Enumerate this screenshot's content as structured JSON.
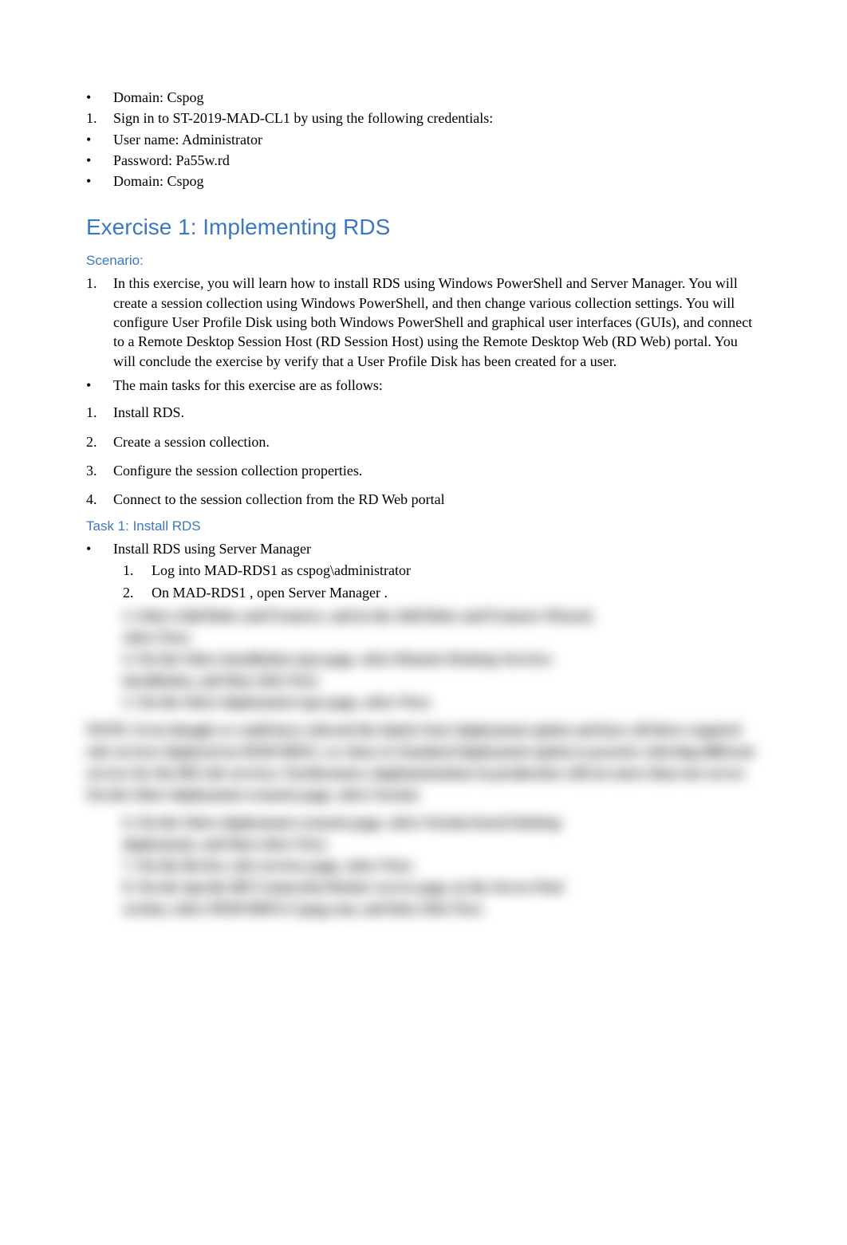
{
  "top": {
    "items": [
      {
        "type": "bullet",
        "text": "Domain: Cspog"
      },
      {
        "type": "number",
        "n": "1.",
        "text": "Sign in to ST-2019-MAD-CL1  by using the following credentials:"
      },
      {
        "type": "bullet",
        "text": "User name:  Administrator"
      },
      {
        "type": "bullet",
        "text": "Password:  Pa55w.rd"
      },
      {
        "type": "bullet",
        "text": "Domain: Cspog"
      }
    ]
  },
  "exercise": {
    "title": "Exercise 1: Implementing RDS",
    "scenario_label": "Scenario:",
    "scenario_body": "In this exercise, you will learn how to install RDS using Windows PowerShell and Server Manager. You will create a session collection using Windows PowerShell, and then change various collection settings. You will configure User Profile Disk using both Windows PowerShell and graphical user interfaces (GUIs), and connect to a Remote Desktop Session Host (RD Session Host) using the Remote Desktop Web (RD Web) portal. You will conclude the exercise by verify that a User Profile Disk has been created for a user.",
    "scenario_num": "1.",
    "tasks_intro": "The main tasks for this exercise are as follows:",
    "tasks": [
      {
        "n": "1.",
        "text": "Install RDS."
      },
      {
        "n": "2.",
        "text": "Create a session collection."
      },
      {
        "n": "3.",
        "text": "Configure the session collection properties."
      },
      {
        "n": "4.",
        "text": "Connect to the session collection from the RD Web portal"
      }
    ]
  },
  "task1": {
    "heading": "Task 1: Install RDS",
    "intro": "Install RDS using Server Manager",
    "steps": [
      {
        "n": "1.",
        "text": "Log into MAD-RDS1 as cspog\\administrator"
      },
      {
        "n": "2.",
        "text": "On MAD-RDS1 , open  Server Manager   ."
      }
    ]
  },
  "blurred": {
    "lines": [
      "3.    Select Add Roles and Features, and in the Add Roles and Features Wizard,",
      "       select Next.",
      "4.    On the Select installation type page, select Remote Desktop Services",
      "       installation, and then click Next.",
      "5.    On the Select deployment type page, select Next."
    ],
    "para": "NOTE: Even though we could have selected the Quick Start deployment option and have all three required role services deployed on MAD-RDS1, we chose to Standard deployment option to practice selecting different servers for the RD role services. Furthermore, implementations in production will use more than one server. On the Select deployment scenario page, select Session",
    "lines2": [
      "6.    On the Select deployment scenario page, select Session-based desktop",
      "       deployment, and then select Next.",
      "7.    On the Review role services page, select Next.",
      "8.    On the Specify RD Connection Broker server page, in the Server Pool",
      "       section, select MAD-RDS1.Cspog.com, and then click Next."
    ]
  }
}
